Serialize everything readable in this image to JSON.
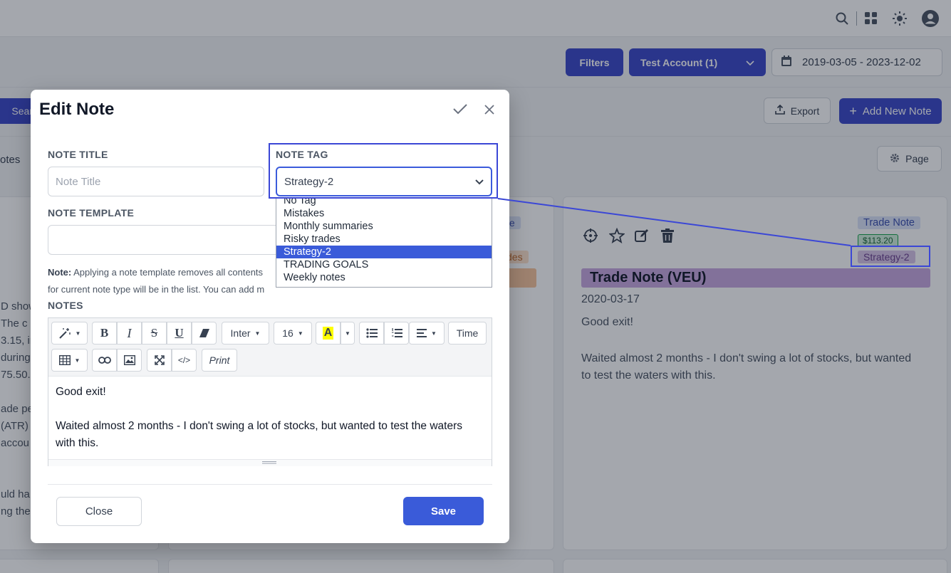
{
  "header": {
    "filters_label": "Filters",
    "account_label": "Test Account (1)",
    "date_range": "2019-03-05 - 2023-12-02"
  },
  "toolbar": {
    "search_partial": "Sear",
    "export_label": "Export",
    "add_note_label": "Add New Note",
    "notes_partial": "otes",
    "page_label": "Page"
  },
  "background_left_lines": [
    "D show",
    "The c",
    "3.15, in",
    "during",
    "75.50.",
    "",
    "ade pe",
    "(ATR)",
    "accou",
    "",
    "",
    "uld ha",
    "ng the",
    ""
  ],
  "background_mid_badges": [
    "te",
    "des"
  ],
  "right_card": {
    "type_badge": "Trade Note",
    "pl_badge": "$113.20",
    "tag_badge": "Strategy-2",
    "title": "Trade Note (VEU)",
    "date": "2020-03-17",
    "body_line1": "Good exit!",
    "body_line2": "Waited almost 2 months - I don't swing a lot of stocks, but wanted to test the waters with this."
  },
  "modal": {
    "title": "Edit Note",
    "note_title_label": "NOTE TITLE",
    "note_title_placeholder": "Note Title",
    "note_tag_label": "NOTE TAG",
    "note_tag_value": "Strategy-2",
    "note_template_label": "NOTE TEMPLATE",
    "template_note_bold": "Note:",
    "template_note_line1": " Applying a note template removes all contents",
    "template_note_line2": "for current note type will be in the list. You can add m",
    "notes_label": "NOTES",
    "tag_options": [
      "No Tag",
      "Mistakes",
      "Monthly summaries",
      "Risky trades",
      "Strategy-2",
      "TRADING GOALS",
      "Weekly notes"
    ],
    "selected_option_index": 4,
    "editor": {
      "font_label": "Inter",
      "size_label": "16",
      "highlight_label": "A",
      "time_label": "Time",
      "print_label": "Print",
      "bold_label": "B",
      "italic_label": "I",
      "strike_label": "S",
      "underline_label": "U",
      "code_label": "</>",
      "body_line1": "Good exit!",
      "body_line2": "Waited almost 2 months - I don't swing a lot of stocks, but wanted to test the waters with this."
    },
    "close_label": "Close",
    "save_label": "Save"
  },
  "colors": {
    "primary": "#3a48c9",
    "save": "#3a5bd9",
    "tag_purple": "#d9c6e8",
    "title_purple": "#c9a9e0",
    "pl_green": "#d1f0dc",
    "type_blue": "#dbe4f8"
  }
}
